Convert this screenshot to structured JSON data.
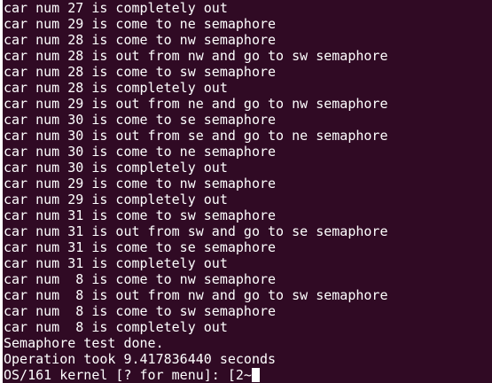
{
  "terminal": {
    "background": "#300a24",
    "foreground": "#ffffff",
    "lines": [
      "car num 27 is completely out",
      "car num 29 is come to ne semaphore",
      "car num 28 is come to nw semaphore",
      "car num 28 is out from nw and go to sw semaphore",
      "car num 28 is come to sw semaphore",
      "car num 28 is completely out",
      "car num 29 is out from ne and go to nw semaphore",
      "car num 30 is come to se semaphore",
      "car num 30 is out from se and go to ne semaphore",
      "car num 30 is come to ne semaphore",
      "car num 30 is completely out",
      "car num 29 is come to nw semaphore",
      "car num 29 is completely out",
      "car num 31 is come to sw semaphore",
      "car num 31 is out from sw and go to se semaphore",
      "car num 31 is come to se semaphore",
      "car num 31 is completely out",
      "car num  8 is come to nw semaphore",
      "car num  8 is out from nw and go to sw semaphore",
      "car num  8 is come to sw semaphore",
      "car num  8 is completely out",
      "Semaphore test done.",
      "Operation took 9.417836440 seconds"
    ],
    "prompt": "OS/161 kernel [? for menu]: [2~"
  }
}
